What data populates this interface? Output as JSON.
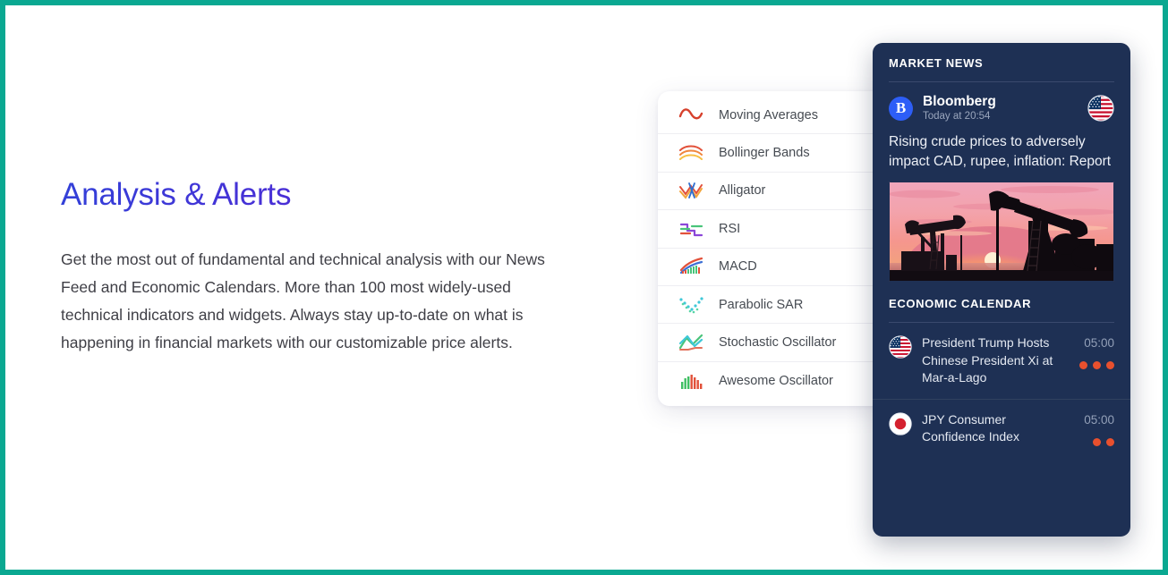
{
  "theme": {
    "frame_border_color": "#0aa891",
    "title_gradient_start": "#3340d8",
    "title_gradient_end": "#7b1fd4",
    "news_panel_bg": "#1e3054",
    "impact_dot_color": "#e8502e"
  },
  "left": {
    "title": "Analysis & Alerts",
    "body": "Get the most out of fundamental and technical analysis with our News Feed and Economic Calendars. More than 100 most widely-used technical indicators and widgets. Always stay up-to-date on what is happening in financial markets with our customizable price alerts."
  },
  "indicators": {
    "items": [
      {
        "label": "Moving Averages",
        "icon": "moving-averages-icon"
      },
      {
        "label": "Bollinger Bands",
        "icon": "bollinger-bands-icon"
      },
      {
        "label": "Alligator",
        "icon": "alligator-icon"
      },
      {
        "label": "RSI",
        "icon": "rsi-icon"
      },
      {
        "label": "MACD",
        "icon": "macd-icon"
      },
      {
        "label": "Parabolic SAR",
        "icon": "parabolic-sar-icon"
      },
      {
        "label": "Stochastic Oscillator",
        "icon": "stochastic-oscillator-icon"
      },
      {
        "label": "Awesome Oscillator",
        "icon": "awesome-oscillator-icon"
      }
    ]
  },
  "news_panel": {
    "market_news_title": "MARKET NEWS",
    "article": {
      "source": "Bloomberg",
      "source_initial": "B",
      "timestamp": "Today at 20:54",
      "country_flag": "us-flag-icon",
      "headline": "Rising crude prices to adversely impact CAD, rupee, inflation: Report",
      "thumbnail": "oil-pumpjacks-at-sunset-photo"
    },
    "economic_calendar_title": "ECONOMIC CALENDAR",
    "calendar_events": [
      {
        "flag": "us-flag-icon",
        "title": "President Trump Hosts Chinese President Xi at Mar-a-Lago",
        "time": "05:00",
        "impact": 3
      },
      {
        "flag": "jp-flag-icon",
        "title": "JPY Consumer Confidence Index",
        "time": "05:00",
        "impact": 2
      }
    ]
  }
}
